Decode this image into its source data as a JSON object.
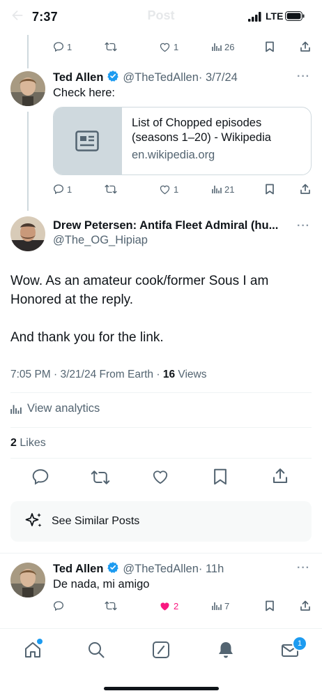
{
  "status_bar": {
    "time": "7:37",
    "network": "LTE",
    "ghost_title": "Post"
  },
  "colors": {
    "accent": "#1d9bf0",
    "like": "#f91880",
    "text": "#0f1419",
    "muted": "#536471"
  },
  "top_tweet_actions": {
    "replies": "1",
    "likes": "1",
    "views": "26"
  },
  "tweet1": {
    "name": "Ted Allen",
    "handle": "@TheTedAllen",
    "date": "· 3/7/24",
    "text": "Check here:",
    "card": {
      "title": "List of Chopped episodes (seasons 1–20) - Wikipedia",
      "domain": "en.wikipedia.org"
    },
    "actions": {
      "replies": "1",
      "likes": "1",
      "views": "21"
    }
  },
  "main_post": {
    "name": "Drew Petersen: Antifa Fleet Admiral (hu...",
    "handle": "@The_OG_Hipiap",
    "text_line1": "Wow. As an amateur cook/former Sous I am",
    "text_line2": "Honored at the reply.",
    "text_line3": "And thank you for the link.",
    "meta_time": "7:05 PM · 3/21/24 From Earth ·",
    "views_count": "16",
    "views_label": "Views",
    "analytics_label": "View analytics",
    "likes_count": "2",
    "likes_label": "Likes",
    "similar_label": "See Similar Posts"
  },
  "reply": {
    "name": "Ted Allen",
    "handle": "@TheTedAllen",
    "date": "· 11h",
    "text": "De nada, mi amigo",
    "actions": {
      "likes": "2",
      "views": "7"
    }
  },
  "bottom_nav": {
    "messages_badge": "1"
  }
}
